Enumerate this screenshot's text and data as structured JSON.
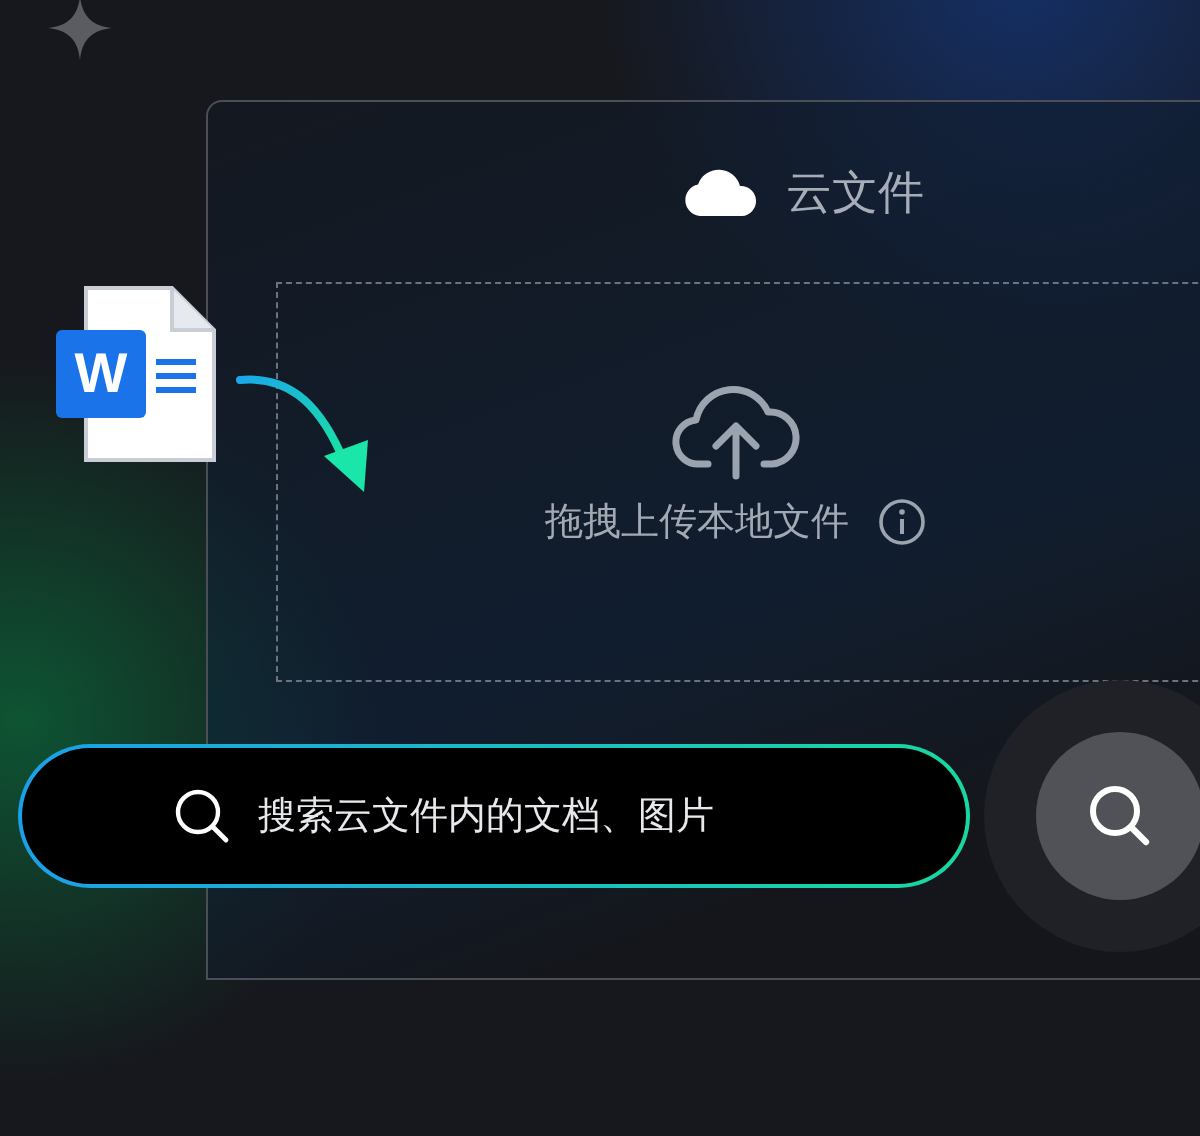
{
  "file_badge": {
    "letter": "W"
  },
  "panel": {
    "title": "云文件"
  },
  "drop_zone": {
    "label": "拖拽上传本地文件"
  },
  "search": {
    "placeholder": "搜索云文件内的文档、图片"
  }
}
